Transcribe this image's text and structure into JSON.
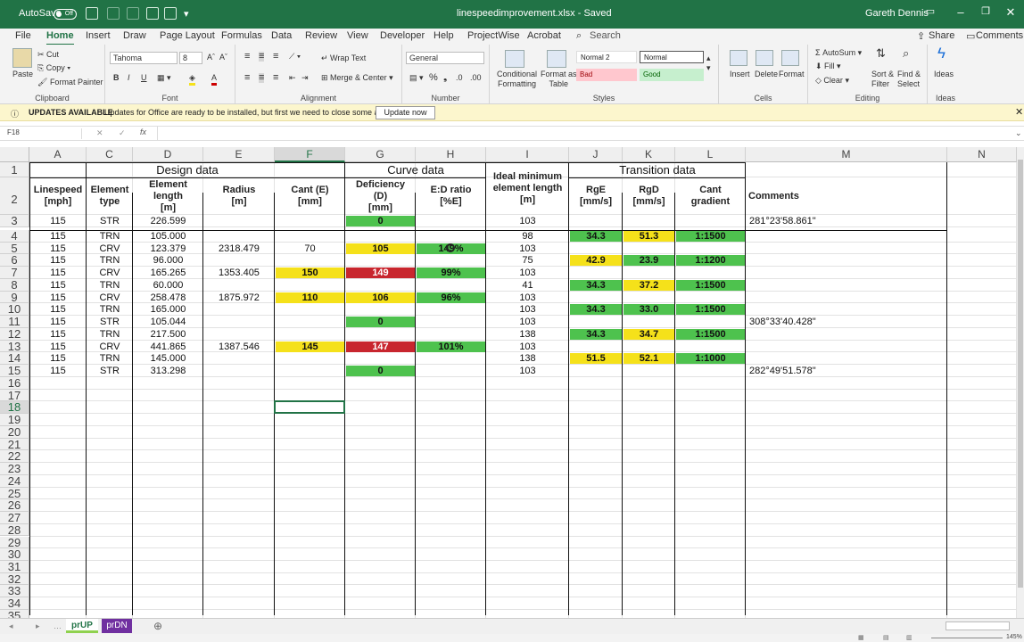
{
  "titlebar": {
    "autosave_label": "AutoSave",
    "autosave_state": "Off",
    "filename": "linespeedimprovement.xlsx",
    "saved_status": "Saved",
    "user": "Gareth Dennis"
  },
  "menu": {
    "tabs": [
      "File",
      "Home",
      "Insert",
      "Draw",
      "Page Layout",
      "Formulas",
      "Data",
      "Review",
      "View",
      "Developer",
      "Help",
      "ProjectWise",
      "Acrobat"
    ],
    "active": "Home",
    "search": "Search",
    "share": "Share",
    "comments": "Comments"
  },
  "ribbon": {
    "clipboard": {
      "paste": "Paste",
      "cut": "Cut",
      "copy": "Copy",
      "format_painter": "Format Painter",
      "label": "Clipboard"
    },
    "font": {
      "name": "Tahoma",
      "size": "8",
      "bold": "B",
      "italic": "I",
      "underline": "U",
      "grow": "Aˆ",
      "shrink": "Aˇ",
      "label": "Font"
    },
    "alignment": {
      "wrap": "Wrap Text",
      "merge": "Merge & Center",
      "label": "Alignment"
    },
    "number": {
      "format": "General",
      "label": "Number"
    },
    "styles": {
      "conditional": "Conditional\nFormatting",
      "format_table": "Format as\nTable",
      "normal2": "Normal 2",
      "normal": "Normal",
      "bad": "Bad",
      "good": "Good",
      "label": "Styles"
    },
    "cells": {
      "insert": "Insert",
      "delete": "Delete",
      "format": "Format",
      "label": "Cells"
    },
    "editing": {
      "autosum": "AutoSum",
      "fill": "Fill",
      "clear": "Clear",
      "sort": "Sort &\nFilter",
      "find": "Find &\nSelect",
      "label": "Editing"
    },
    "ideas": {
      "ideas": "Ideas",
      "label": "Ideas"
    }
  },
  "updates": {
    "title": "UPDATES AVAILABLE",
    "message": "Updates for Office are ready to be installed, but first we need to close some apps.",
    "button": "Update now"
  },
  "formula_bar": {
    "name_box": "F18",
    "fx": "fx",
    "content": ""
  },
  "columns": [
    "A",
    "C",
    "D",
    "E",
    "F",
    "G",
    "H",
    "I",
    "J",
    "K",
    "L",
    "M",
    "N"
  ],
  "selected_column": "F",
  "selected_row": "18",
  "rows": [
    "1",
    "2",
    "3",
    "4",
    "5",
    "6",
    "7",
    "8",
    "9",
    "10",
    "11",
    "12",
    "13",
    "14",
    "15",
    "16",
    "17",
    "18",
    "19",
    "20",
    "21",
    "22",
    "23",
    "24",
    "25",
    "26",
    "27",
    "28",
    "29",
    "30",
    "31",
    "32",
    "33",
    "34",
    "35"
  ],
  "groups": {
    "design": "Design data",
    "curve": "Curve data",
    "transition": "Transition data"
  },
  "headers": {
    "A": "Linespeed\n[mph]",
    "C": "Element\ntype",
    "D": "Element\nlength\n[m]",
    "E": "Radius\n[m]",
    "F": "Cant (E)\n[mm]",
    "G": "Deficiency\n(D)\n[mm]",
    "H": "E:D ratio\n[%E]",
    "I": "Ideal minimum\nelement length\n[m]",
    "J": "RgE\n[mm/s]",
    "K": "RgD\n[mm/s]",
    "L": "Cant\ngradient",
    "M": "Comments"
  },
  "data_rows": [
    {
      "A": "115",
      "C": "STR",
      "D": "226.599",
      "E": "",
      "F": "",
      "G": "0",
      "H": "",
      "I": "103",
      "J": "",
      "K": "",
      "L": "",
      "M": "281°23'58.861\""
    },
    {
      "A": "115",
      "C": "TRN",
      "D": "105.000",
      "E": "",
      "F": "",
      "G": "",
      "H": "",
      "I": "98",
      "J": "34.3",
      "K": "51.3",
      "L": "1:1500",
      "M": ""
    },
    {
      "A": "115",
      "C": "CRV",
      "D": "123.379",
      "E": "2318.479",
      "F": "70",
      "G": "105",
      "H": "149%",
      "I": "103",
      "J": "",
      "K": "",
      "L": "",
      "M": ""
    },
    {
      "A": "115",
      "C": "TRN",
      "D": "96.000",
      "E": "",
      "F": "",
      "G": "",
      "H": "",
      "I": "75",
      "J": "42.9",
      "K": "23.9",
      "L": "1:1200",
      "M": ""
    },
    {
      "A": "115",
      "C": "CRV",
      "D": "165.265",
      "E": "1353.405",
      "F": "150",
      "G": "149",
      "H": "99%",
      "I": "103",
      "J": "",
      "K": "",
      "L": "",
      "M": ""
    },
    {
      "A": "115",
      "C": "TRN",
      "D": "60.000",
      "E": "",
      "F": "",
      "G": "",
      "H": "",
      "I": "41",
      "J": "34.3",
      "K": "37.2",
      "L": "1:1500",
      "M": ""
    },
    {
      "A": "115",
      "C": "CRV",
      "D": "258.478",
      "E": "1875.972",
      "F": "110",
      "G": "106",
      "H": "96%",
      "I": "103",
      "J": "",
      "K": "",
      "L": "",
      "M": ""
    },
    {
      "A": "115",
      "C": "TRN",
      "D": "165.000",
      "E": "",
      "F": "",
      "G": "",
      "H": "",
      "I": "103",
      "J": "34.3",
      "K": "33.0",
      "L": "1:1500",
      "M": ""
    },
    {
      "A": "115",
      "C": "STR",
      "D": "105.044",
      "E": "",
      "F": "",
      "G": "0",
      "H": "",
      "I": "103",
      "J": "",
      "K": "",
      "L": "",
      "M": "308°33'40.428\""
    },
    {
      "A": "115",
      "C": "TRN",
      "D": "217.500",
      "E": "",
      "F": "",
      "G": "",
      "H": "",
      "I": "138",
      "J": "34.3",
      "K": "34.7",
      "L": "1:1500",
      "M": ""
    },
    {
      "A": "115",
      "C": "CRV",
      "D": "441.865",
      "E": "1387.546",
      "F": "145",
      "G": "147",
      "H": "101%",
      "I": "103",
      "J": "",
      "K": "",
      "L": "",
      "M": ""
    },
    {
      "A": "115",
      "C": "TRN",
      "D": "145.000",
      "E": "",
      "F": "",
      "G": "",
      "H": "",
      "I": "138",
      "J": "51.5",
      "K": "52.1",
      "L": "1:1000",
      "M": ""
    },
    {
      "A": "115",
      "C": "STR",
      "D": "313.298",
      "E": "",
      "F": "",
      "G": "0",
      "H": "",
      "I": "103",
      "J": "",
      "K": "",
      "L": "",
      "M": "282°49'51.578\""
    }
  ],
  "highlights": {
    "colors": {
      "green": "#4ec24e",
      "yellow": "#f5e11a",
      "red": "#c8262e"
    },
    "cells": [
      {
        "row": 0,
        "col": "G",
        "color": "green"
      },
      {
        "row": 1,
        "col": "J",
        "color": "green"
      },
      {
        "row": 1,
        "col": "K",
        "color": "yellow"
      },
      {
        "row": 1,
        "col": "L",
        "color": "green"
      },
      {
        "row": 2,
        "col": "G",
        "color": "yellow"
      },
      {
        "row": 2,
        "col": "H",
        "color": "green"
      },
      {
        "row": 3,
        "col": "J",
        "color": "yellow"
      },
      {
        "row": 3,
        "col": "K",
        "color": "green"
      },
      {
        "row": 3,
        "col": "L",
        "color": "green"
      },
      {
        "row": 4,
        "col": "F",
        "color": "yellow"
      },
      {
        "row": 4,
        "col": "G",
        "color": "red"
      },
      {
        "row": 4,
        "col": "H",
        "color": "green"
      },
      {
        "row": 5,
        "col": "J",
        "color": "green"
      },
      {
        "row": 5,
        "col": "K",
        "color": "yellow"
      },
      {
        "row": 5,
        "col": "L",
        "color": "green"
      },
      {
        "row": 6,
        "col": "F",
        "color": "yellow"
      },
      {
        "row": 6,
        "col": "G",
        "color": "yellow"
      },
      {
        "row": 6,
        "col": "H",
        "color": "green"
      },
      {
        "row": 7,
        "col": "J",
        "color": "green"
      },
      {
        "row": 7,
        "col": "K",
        "color": "green"
      },
      {
        "row": 7,
        "col": "L",
        "color": "green"
      },
      {
        "row": 8,
        "col": "G",
        "color": "green"
      },
      {
        "row": 9,
        "col": "J",
        "color": "green"
      },
      {
        "row": 9,
        "col": "K",
        "color": "yellow"
      },
      {
        "row": 9,
        "col": "L",
        "color": "green"
      },
      {
        "row": 10,
        "col": "F",
        "color": "yellow"
      },
      {
        "row": 10,
        "col": "G",
        "color": "red"
      },
      {
        "row": 10,
        "col": "H",
        "color": "green"
      },
      {
        "row": 11,
        "col": "J",
        "color": "yellow"
      },
      {
        "row": 11,
        "col": "K",
        "color": "yellow"
      },
      {
        "row": 11,
        "col": "L",
        "color": "green"
      },
      {
        "row": 12,
        "col": "G",
        "color": "green"
      }
    ]
  },
  "sheets": [
    {
      "name": "prUP",
      "active": true,
      "color": "#8fd14f"
    },
    {
      "name": "prDN",
      "active": false,
      "color": "#7030a0"
    }
  ],
  "zoom": "145%"
}
